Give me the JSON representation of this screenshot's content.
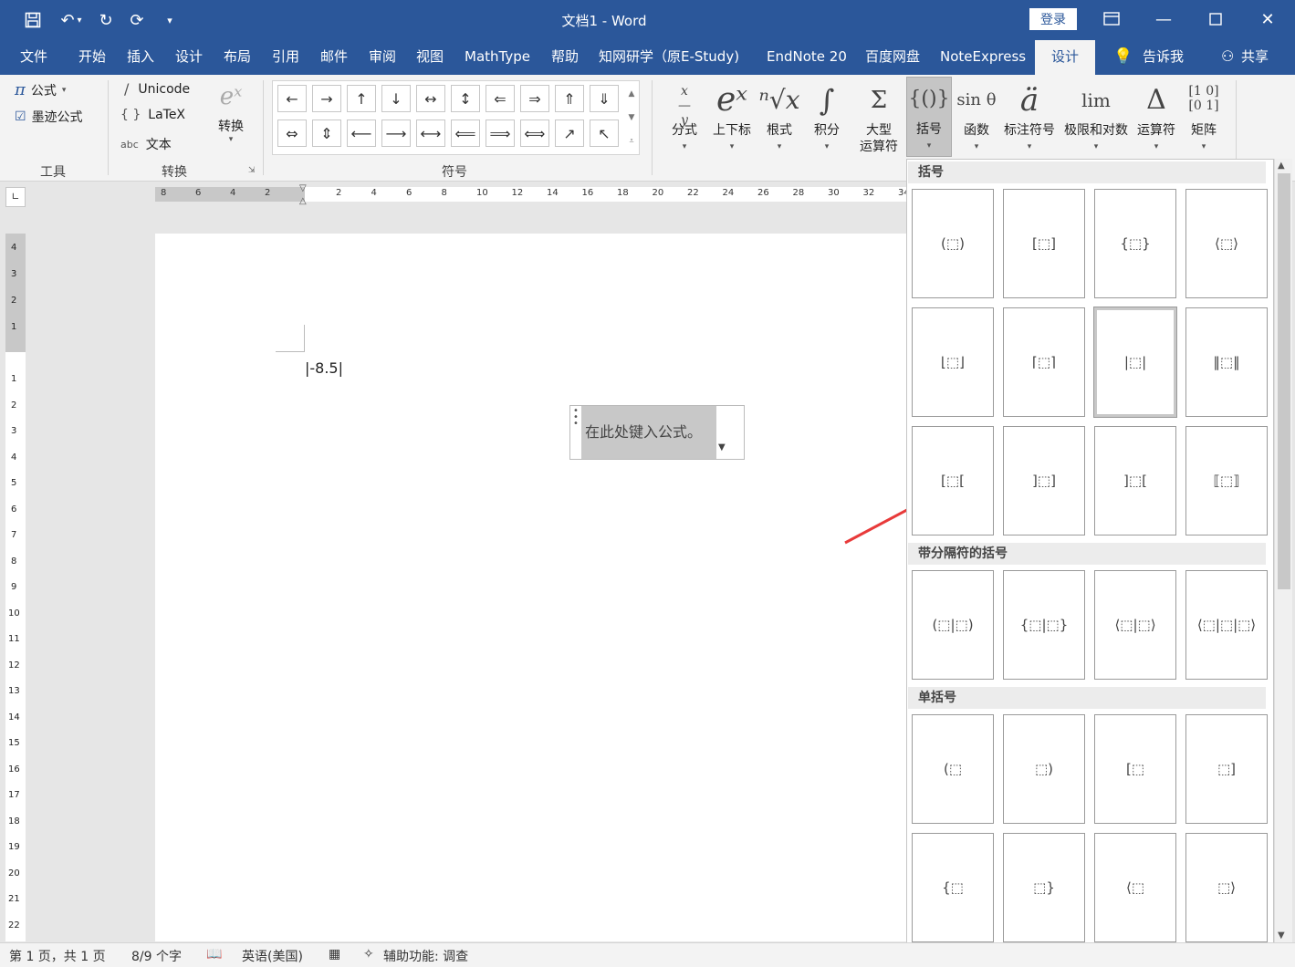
{
  "titlebar": {
    "title": "文档1  -  Word",
    "login": "登录",
    "icons": [
      "save-icon",
      "undo-icon",
      "redo-icon",
      "repeat-icon",
      "customize-icon"
    ]
  },
  "tabs": [
    "文件",
    "开始",
    "插入",
    "设计",
    "布局",
    "引用",
    "邮件",
    "审阅",
    "视图",
    "MathType",
    "帮助",
    "知网研学（原E-Study)",
    "EndNote 20",
    "百度网盘",
    "NoteExpress",
    "设计"
  ],
  "tell_me": "告诉我",
  "share": "共享",
  "ribbon": {
    "tools": {
      "formula": "公式",
      "ink": "墨迹公式",
      "label": "工具"
    },
    "convert": {
      "unicode": "Unicode",
      "latex": "LaTeX",
      "text": "文本",
      "convert": "转换",
      "label": "转换",
      "pi": "π",
      "braces": "{ }",
      "slash": "/",
      "abc": "abc"
    },
    "symbols": {
      "label": "符号",
      "row1": [
        "←",
        "→",
        "↑",
        "↓",
        "↔",
        "↕",
        "⇐",
        "⇒",
        "⇑",
        "⇓"
      ],
      "row2": [
        "⇔",
        "⇕",
        "⟵",
        "⟶",
        "⟷",
        "⟸",
        "⟹",
        "⟺",
        "↗",
        "↖"
      ]
    },
    "structures": [
      {
        "icon": "x/y",
        "label": "分式"
      },
      {
        "icon": "eˣ",
        "label": "上下标"
      },
      {
        "icon": "ⁿ√x",
        "label": "根式"
      },
      {
        "icon": "∫",
        "label": "积分"
      },
      {
        "icon": "Σ",
        "label": "大型\n运算符"
      },
      {
        "icon": "{()}",
        "label": "括号"
      },
      {
        "icon": "sin θ",
        "label": "函数"
      },
      {
        "icon": "ä",
        "label": "标注符号"
      },
      {
        "icon": "lim",
        "label": "极限和对数"
      },
      {
        "icon": "Δ",
        "label": "运算符"
      },
      {
        "icon": "[10;01]",
        "label": "矩阵"
      }
    ]
  },
  "document": {
    "equation_text": "|-8.5|",
    "placeholder": "在此处键入公式。"
  },
  "ruler": {
    "h_left": [
      "8",
      "6",
      "4",
      "2"
    ],
    "h_right": [
      "2",
      "4",
      "6",
      "8",
      "10",
      "12",
      "14",
      "16",
      "18",
      "20",
      "22",
      "24",
      "26",
      "28",
      "30",
      "32",
      "34"
    ],
    "v_top": [
      "4",
      "3",
      "2",
      "1"
    ],
    "v": [
      "1",
      "2",
      "3",
      "4",
      "5",
      "6",
      "7",
      "8",
      "9",
      "10",
      "11",
      "12",
      "13",
      "14",
      "15",
      "16",
      "17",
      "18",
      "19",
      "20",
      "21",
      "22"
    ]
  },
  "gallery": {
    "sections": [
      {
        "title": "括号",
        "items": [
          "(⬚)",
          "[⬚]",
          "{⬚}",
          "⟨⬚⟩",
          "⌊⬚⌋",
          "⌈⬚⌉",
          "|⬚|",
          "‖⬚‖",
          "[⬚[",
          "]⬚]",
          "]⬚[",
          "⟦⬚⟧"
        ]
      },
      {
        "title": "带分隔符的括号",
        "items": [
          "(⬚|⬚)",
          "{⬚|⬚}",
          "⟨⬚|⬚⟩",
          "⟨⬚|⬚|⬚⟩"
        ]
      },
      {
        "title": "单括号",
        "items": [
          "(⬚",
          "⬚)",
          "[⬚",
          "⬚]",
          "{⬚",
          "⬚}",
          "⟨⬚",
          "⬚⟩"
        ]
      }
    ],
    "selected": "|⬚|"
  },
  "status": {
    "page": "第 1 页，共 1 页",
    "words": "8/9 个字",
    "lang": "英语(美国)",
    "access": "辅助功能: 调查"
  },
  "colors": {
    "accent": "#2b579a",
    "arrow": "#e83a3a"
  }
}
